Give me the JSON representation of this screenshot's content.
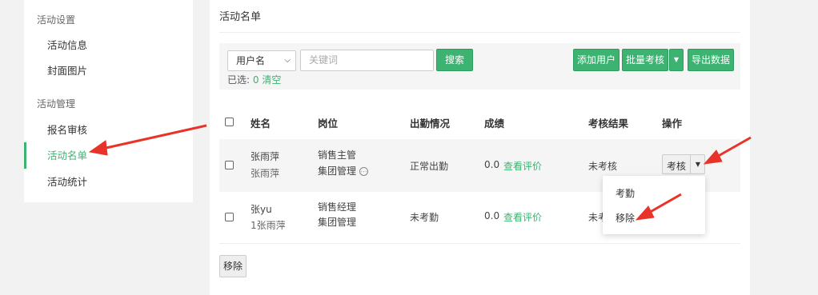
{
  "sidebar": {
    "group1": "活动设置",
    "group1_items": [
      "活动信息",
      "封面图片"
    ],
    "group2": "活动管理",
    "group2_items": [
      "报名审核",
      "活动名单",
      "活动统计"
    ]
  },
  "main": {
    "title": "活动名单",
    "filter": {
      "field": "用户名",
      "keyword_placeholder": "关键词",
      "search": "搜索"
    },
    "actions": {
      "add_user": "添加用户",
      "batch_assess": "批量考核",
      "export": "导出数据"
    },
    "selection": {
      "label": "已选: ",
      "count": "0",
      "clear": "清空"
    },
    "columns": [
      "姓名",
      "岗位",
      "出勤情况",
      "成绩",
      "考核结果",
      "操作"
    ],
    "rows": [
      {
        "name": "张雨萍",
        "sub_name": "张雨萍",
        "position": "销售主管",
        "department": "集团管理",
        "attendance": "正常出勤",
        "score": "0.0",
        "view": "查看评价",
        "result": "未考核",
        "op": "考核"
      },
      {
        "name": "张yu",
        "sub_name": "1张雨萍",
        "position": "销售经理",
        "department": "集团管理",
        "attendance": "未考勤",
        "score": "0.0",
        "view": "查看评价",
        "result": "未考"
      }
    ],
    "dropdown": [
      "考勤",
      "移除"
    ],
    "remove_btn": "移除"
  },
  "colors": {
    "accent": "#3cb371",
    "annotation": "#e8332a"
  }
}
